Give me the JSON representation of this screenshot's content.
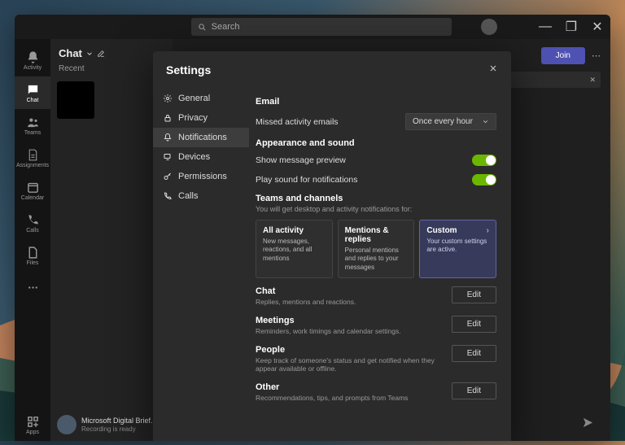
{
  "titlebar": {
    "search_placeholder": "Search"
  },
  "win": {
    "min": "—",
    "max": "❐",
    "close": "✕"
  },
  "rail": {
    "items": [
      {
        "label": "Activity"
      },
      {
        "label": "Chat"
      },
      {
        "label": "Teams"
      },
      {
        "label": "Assignments"
      },
      {
        "label": "Calendar"
      },
      {
        "label": "Calls"
      },
      {
        "label": "Files"
      }
    ],
    "apps": "Apps"
  },
  "chat": {
    "header": "Chat",
    "tab_recent": "Recent",
    "recent": {
      "title": "Microsoft Digital Brief...",
      "sub": "Recording is ready"
    }
  },
  "meeting": {
    "join": "Join"
  },
  "settings": {
    "title": "Settings",
    "nav": {
      "general": "General",
      "privacy": "Privacy",
      "notifications": "Notifications",
      "devices": "Devices",
      "permissions": "Permissions",
      "calls": "Calls"
    },
    "email": {
      "heading": "Email",
      "missed_label": "Missed activity emails",
      "missed_value": "Once every hour"
    },
    "appearance": {
      "heading": "Appearance and sound",
      "preview_label": "Show message preview",
      "sound_label": "Play sound for notifications"
    },
    "teams": {
      "heading": "Teams and channels",
      "sub": "You will get desktop and activity notifications for:",
      "cards": [
        {
          "title": "All activity",
          "sub": "New messages, reactions, and all mentions"
        },
        {
          "title": "Mentions & replies",
          "sub": "Personal mentions and replies to your messages"
        },
        {
          "title": "Custom",
          "sub": "Your custom settings are active."
        }
      ]
    },
    "groups": [
      {
        "title": "Chat",
        "sub": "Replies, mentions and reactions.",
        "btn": "Edit"
      },
      {
        "title": "Meetings",
        "sub": "Reminders, work timings and calendar settings.",
        "btn": "Edit"
      },
      {
        "title": "People",
        "sub": "Keep track of someone's status and get notified when they appear available or offline.",
        "btn": "Edit"
      },
      {
        "title": "Other",
        "sub": "Recommendations, tips, and prompts from Teams",
        "btn": "Edit"
      }
    ]
  }
}
